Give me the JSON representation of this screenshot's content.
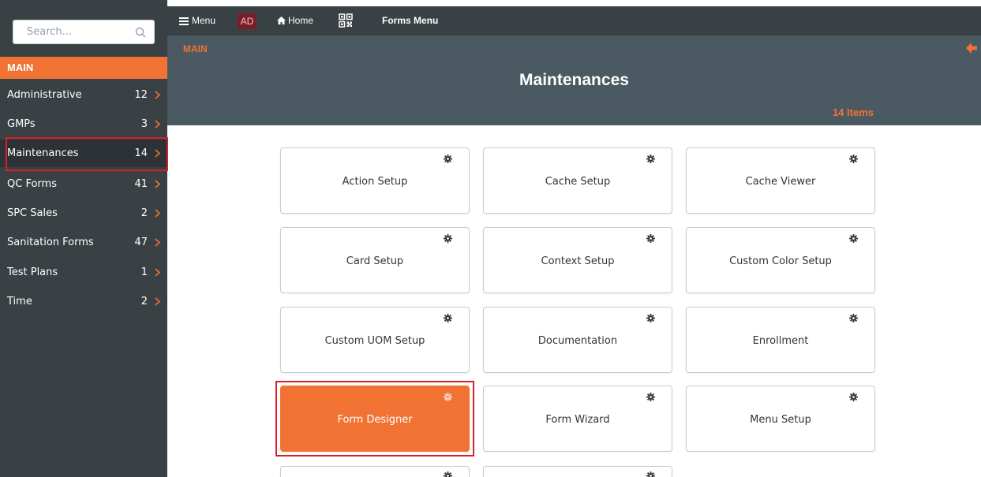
{
  "sidebar": {
    "search_placeholder": "Search...",
    "section_label": "MAIN",
    "items": [
      {
        "label": "Administrative",
        "count": "12"
      },
      {
        "label": "GMPs",
        "count": "3"
      },
      {
        "label": "Maintenances",
        "count": "14"
      },
      {
        "label": "QC Forms",
        "count": "41"
      },
      {
        "label": "SPC Sales",
        "count": "2"
      },
      {
        "label": "Sanitation Forms",
        "count": "47"
      },
      {
        "label": "Test Plans",
        "count": "1"
      },
      {
        "label": "Time",
        "count": "2"
      }
    ]
  },
  "topbar": {
    "menu_label": "Menu",
    "user_initials": "AD",
    "home_label": "Home",
    "title": "Forms Menu"
  },
  "header": {
    "breadcrumb": "MAIN",
    "title": "Maintenances",
    "item_count": "14 Items"
  },
  "cards": [
    {
      "label": "Action Setup"
    },
    {
      "label": "Cache Setup"
    },
    {
      "label": "Cache Viewer"
    },
    {
      "label": "Card Setup"
    },
    {
      "label": "Context Setup"
    },
    {
      "label": "Custom Color Setup"
    },
    {
      "label": "Custom UOM Setup"
    },
    {
      "label": "Documentation"
    },
    {
      "label": "Enrollment"
    },
    {
      "label": "Form Designer"
    },
    {
      "label": "Form Wizard"
    },
    {
      "label": "Menu Setup"
    }
  ],
  "colors": {
    "accent": "#f07333",
    "sidebar_bg": "#3a4145",
    "header_bg": "#4b5a62",
    "highlight_outline": "#d62027"
  }
}
